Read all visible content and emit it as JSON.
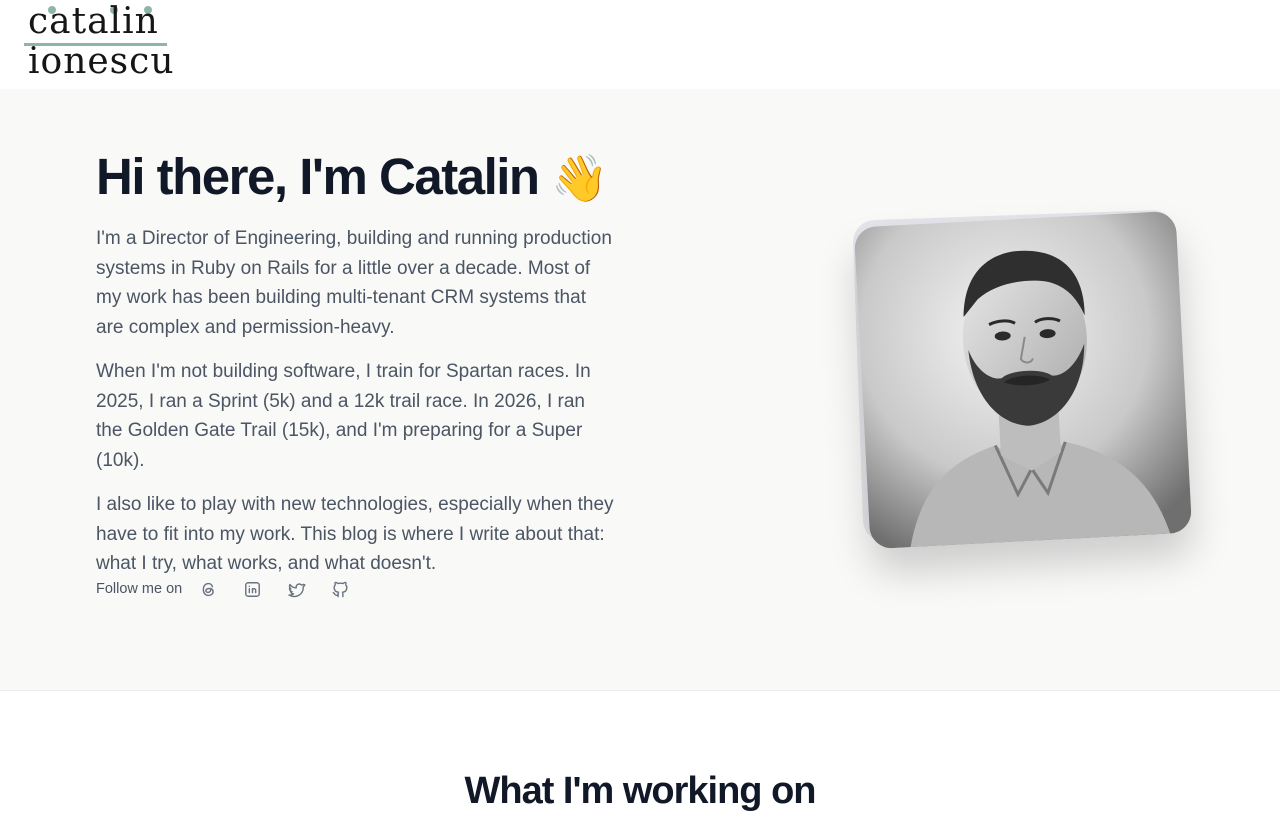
{
  "header": {
    "logo_line1": "catalin",
    "logo_line2": "ionescu",
    "logo_accent": "#8fb5a6"
  },
  "hero": {
    "title": "Hi there, I'm Catalin",
    "wave_emoji": "👋",
    "paragraphs": [
      "I'm a Director of Engineering, building and running production systems in Ruby on Rails for a little over a decade. Most of my work has been building multi-tenant CRM systems that are complex and permission-heavy.",
      "When I'm not building software, I train for Spartan races. In 2025, I ran a Sprint (5k) and a 12k trail race. In 2026, I ran the Golden Gate Trail (15k), and I'm preparing for a Super (10k).",
      "I also like to play with new technologies, especially when they have to fit into my work. This blog is where I write about that: what I try, what works, and what doesn't."
    ],
    "follow_label": "Follow me on",
    "social_icons": [
      "threads-icon",
      "linkedin-icon",
      "twitter-icon",
      "github-icon"
    ]
  },
  "next_section": {
    "title": "What I'm working on"
  },
  "colors": {
    "hero_background": "#f9f9f8",
    "heading": "#111827",
    "body_text": "#4b5563",
    "icon": "#6b7280"
  }
}
